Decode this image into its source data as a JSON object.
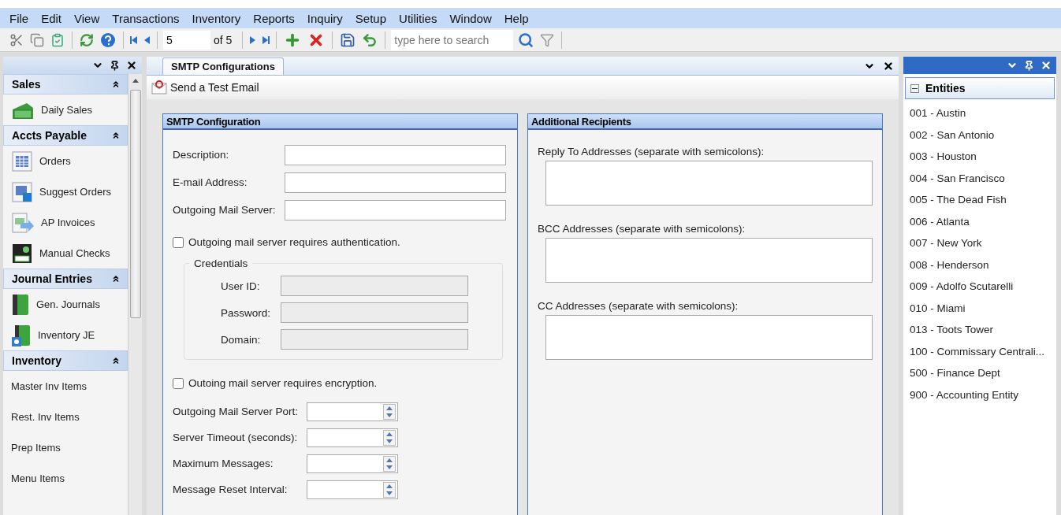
{
  "menu": [
    "File",
    "Edit",
    "View",
    "Transactions",
    "Inventory",
    "Reports",
    "Inquiry",
    "Setup",
    "Utilities",
    "Window",
    "Help"
  ],
  "toolbar": {
    "record": "5",
    "record_count": "of 5",
    "search_placeholder": "type here to search"
  },
  "left_panel": {
    "groups": [
      {
        "title": "Sales",
        "expanded": true,
        "items": [
          {
            "label": "Daily Sales",
            "kind": "cash"
          }
        ]
      },
      {
        "title": "Accts Payable",
        "expanded": true,
        "items": [
          {
            "label": "Orders",
            "kind": "grid"
          },
          {
            "label": "Suggest Orders",
            "kind": "suggest"
          },
          {
            "label": "AP Invoices",
            "kind": "invoice"
          },
          {
            "label": "Manual Checks",
            "kind": "checks"
          }
        ]
      },
      {
        "title": "Journal Entries",
        "expanded": true,
        "items": [
          {
            "label": "Gen. Journals",
            "kind": "journal"
          },
          {
            "label": "Inventory JE",
            "kind": "journalgear"
          }
        ]
      },
      {
        "title": "Inventory",
        "expanded": true,
        "items": [
          {
            "label": "Master Inv Items",
            "kind": "plain"
          },
          {
            "label": "Rest. Inv Items",
            "kind": "plain"
          },
          {
            "label": "Prep Items",
            "kind": "plain"
          },
          {
            "label": "Menu Items",
            "kind": "plain"
          }
        ]
      }
    ]
  },
  "document_tabs": [
    {
      "label": "SMTP Configurations",
      "selected": true
    }
  ],
  "action": "Send a Test Email",
  "smtp": {
    "title": "SMTP Configuration",
    "fields": [
      {
        "label": "Description:"
      },
      {
        "label": "E-mail Address:"
      },
      {
        "label": "Outgoing Mail Server:"
      }
    ],
    "auth": {
      "label": "Outgoing mail server requires authentication.",
      "checked": false
    },
    "credentials": {
      "title": "Credentials",
      "disabled": true,
      "fields": [
        {
          "label": "User ID:"
        },
        {
          "label": "Password:"
        },
        {
          "label": "Domain:"
        }
      ]
    },
    "encryption": {
      "label": "Outoing mail server requires encryption.",
      "checked": false
    },
    "spin_fields": [
      {
        "label": "Outgoing Mail Server Port:"
      },
      {
        "label": "Server Timeout (seconds):"
      },
      {
        "label": "Maximum Messages:"
      },
      {
        "label": "Message Reset Interval:"
      }
    ]
  },
  "recipients": {
    "title": "Additional Recipients",
    "fields": [
      {
        "label": "Reply To Addresses (separate with semicolons):"
      },
      {
        "label": "BCC Addresses (separate with semicolons):"
      },
      {
        "label": "CC Addresses (separate with semicolons):"
      }
    ]
  },
  "entities": {
    "title": "Entities",
    "expanded": true,
    "items": [
      "001 - Austin",
      "002 - San Antonio",
      "003 - Houston",
      "004 - San Francisco",
      "005 - The Dead Fish",
      "006 - Atlanta",
      "007 - New York",
      "008 - Henderson",
      "009 - Adolfo Scutarelli",
      "010 - Miami",
      "013 - Toots Tower",
      "100 - Commissary Centrali...",
      "500 - Finance Dept",
      "900 - Accounting Entity"
    ]
  }
}
